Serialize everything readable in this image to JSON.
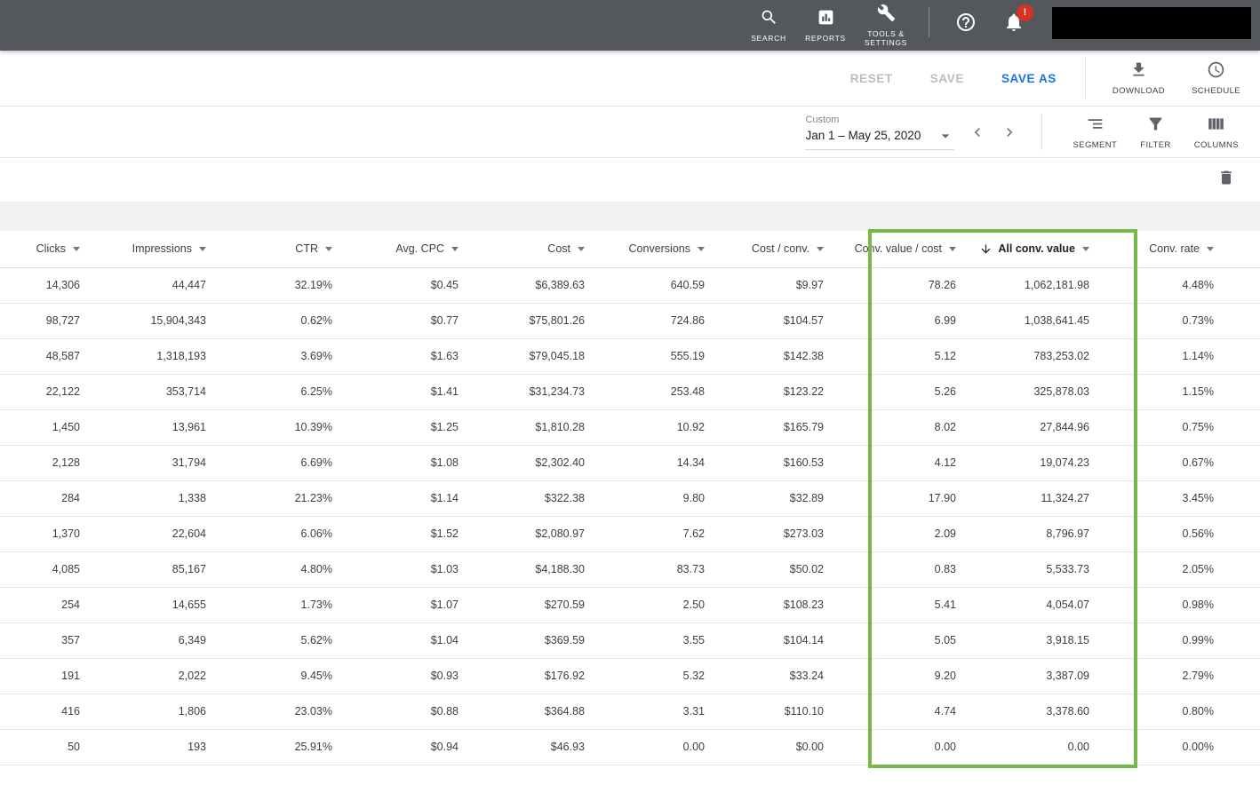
{
  "topbar": {
    "nav": [
      {
        "key": "search",
        "label": "SEARCH"
      },
      {
        "key": "reports",
        "label": "REPORTS"
      },
      {
        "key": "tools",
        "label": "TOOLS &\nSETTINGS"
      }
    ],
    "notification_badge": "!"
  },
  "toolbar": {
    "reset_label": "RESET",
    "save_label": "SAVE",
    "save_as_label": "SAVE AS",
    "download_label": "DOWNLOAD",
    "schedule_label": "SCHEDULE"
  },
  "date_range": {
    "preset": "Custom",
    "value": "Jan 1 – May 25, 2020"
  },
  "view_controls": {
    "segment_label": "SEGMENT",
    "filter_label": "FILTER",
    "columns_label": "COLUMNS"
  },
  "highlight": {
    "color": "#76b947",
    "columns": [
      "Conv. value / cost",
      "All conv. value"
    ]
  },
  "table": {
    "columns": [
      {
        "label": "Clicks"
      },
      {
        "label": "Impressions"
      },
      {
        "label": "CTR"
      },
      {
        "label": "Avg. CPC"
      },
      {
        "label": "Cost"
      },
      {
        "label": "Conversions"
      },
      {
        "label": "Cost / conv."
      },
      {
        "label": "Conv. value / cost",
        "highlighted": true
      },
      {
        "label": "All conv. value",
        "highlighted": true,
        "sorted": "desc"
      },
      {
        "label": "Conv. rate"
      }
    ],
    "rows": [
      [
        "14,306",
        "44,447",
        "32.19%",
        "$0.45",
        "$6,389.63",
        "640.59",
        "$9.97",
        "78.26",
        "1,062,181.98",
        "4.48%"
      ],
      [
        "98,727",
        "15,904,343",
        "0.62%",
        "$0.77",
        "$75,801.26",
        "724.86",
        "$104.57",
        "6.99",
        "1,038,641.45",
        "0.73%"
      ],
      [
        "48,587",
        "1,318,193",
        "3.69%",
        "$1.63",
        "$79,045.18",
        "555.19",
        "$142.38",
        "5.12",
        "783,253.02",
        "1.14%"
      ],
      [
        "22,122",
        "353,714",
        "6.25%",
        "$1.41",
        "$31,234.73",
        "253.48",
        "$123.22",
        "5.26",
        "325,878.03",
        "1.15%"
      ],
      [
        "1,450",
        "13,961",
        "10.39%",
        "$1.25",
        "$1,810.28",
        "10.92",
        "$165.79",
        "8.02",
        "27,844.96",
        "0.75%"
      ],
      [
        "2,128",
        "31,794",
        "6.69%",
        "$1.08",
        "$2,302.40",
        "14.34",
        "$160.53",
        "4.12",
        "19,074.23",
        "0.67%"
      ],
      [
        "284",
        "1,338",
        "21.23%",
        "$1.14",
        "$322.38",
        "9.80",
        "$32.89",
        "17.90",
        "11,324.27",
        "3.45%"
      ],
      [
        "1,370",
        "22,604",
        "6.06%",
        "$1.52",
        "$2,080.97",
        "7.62",
        "$273.03",
        "2.09",
        "8,796.97",
        "0.56%"
      ],
      [
        "4,085",
        "85,167",
        "4.80%",
        "$1.03",
        "$4,188.30",
        "83.73",
        "$50.02",
        "0.83",
        "5,533.73",
        "2.05%"
      ],
      [
        "254",
        "14,655",
        "1.73%",
        "$1.07",
        "$270.59",
        "2.50",
        "$108.23",
        "5.41",
        "4,054.07",
        "0.98%"
      ],
      [
        "357",
        "6,349",
        "5.62%",
        "$1.04",
        "$369.59",
        "3.55",
        "$104.14",
        "5.05",
        "3,918.15",
        "0.99%"
      ],
      [
        "191",
        "2,022",
        "9.45%",
        "$0.93",
        "$176.92",
        "5.32",
        "$33.24",
        "9.20",
        "3,387.09",
        "2.79%"
      ],
      [
        "416",
        "1,806",
        "23.03%",
        "$0.88",
        "$364.88",
        "3.31",
        "$110.10",
        "4.74",
        "3,378.60",
        "0.80%"
      ],
      [
        "50",
        "193",
        "25.91%",
        "$0.94",
        "$46.93",
        "0.00",
        "$0.00",
        "0.00",
        "0.00",
        "0.00%"
      ]
    ]
  }
}
